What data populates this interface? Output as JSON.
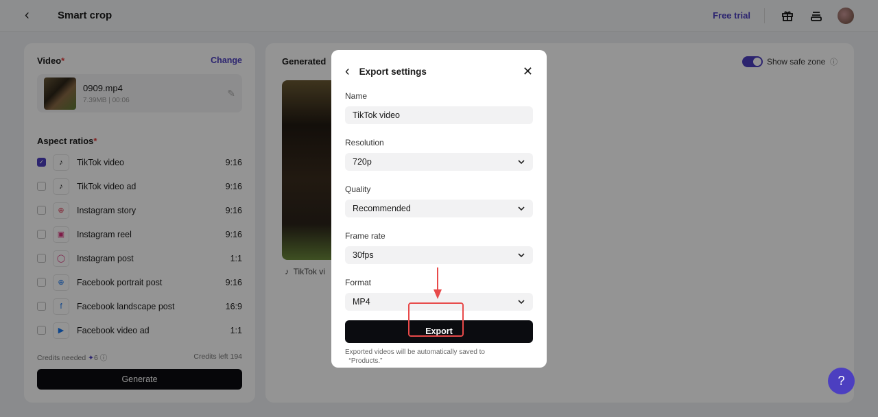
{
  "header": {
    "title": "Smart crop",
    "free_trial": "Free trial"
  },
  "left": {
    "video_label": "Video",
    "change": "Change",
    "video": {
      "name": "0909.mp4",
      "size": "7.39MB",
      "duration": "00:06"
    },
    "aspect_label": "Aspect ratios",
    "items": [
      {
        "name": "TikTok video",
        "ratio": "9:16",
        "checked": true,
        "icon": "tiktok-icon"
      },
      {
        "name": "TikTok video ad",
        "ratio": "9:16",
        "checked": false,
        "icon": "tiktok-icon"
      },
      {
        "name": "Instagram story",
        "ratio": "9:16",
        "checked": false,
        "icon": "instagram-story-icon"
      },
      {
        "name": "Instagram reel",
        "ratio": "9:16",
        "checked": false,
        "icon": "instagram-reel-icon"
      },
      {
        "name": "Instagram post",
        "ratio": "1:1",
        "checked": false,
        "icon": "instagram-icon"
      },
      {
        "name": "Facebook portrait post",
        "ratio": "9:16",
        "checked": false,
        "icon": "facebook-story-icon"
      },
      {
        "name": "Facebook landscape post",
        "ratio": "16:9",
        "checked": false,
        "icon": "facebook-icon"
      },
      {
        "name": "Facebook video ad",
        "ratio": "1:1",
        "checked": false,
        "icon": "facebook-video-icon"
      }
    ],
    "credits_needed": "Credits needed",
    "credits_value": "6",
    "credits_left": "Credits left 194",
    "generate": "Generate"
  },
  "main": {
    "title": "Generated",
    "safe_zone": "Show safe zone",
    "safe_zone_on": true,
    "preview_label": "TikTok vi"
  },
  "modal": {
    "title": "Export settings",
    "fields": [
      {
        "label": "Name",
        "value": "TikTok video",
        "type": "input"
      },
      {
        "label": "Resolution",
        "value": "720p",
        "type": "select"
      },
      {
        "label": "Quality",
        "value": "Recommended",
        "type": "select"
      },
      {
        "label": "Frame rate",
        "value": "30fps",
        "type": "select"
      },
      {
        "label": "Format",
        "value": "MP4",
        "type": "select"
      }
    ],
    "export": "Export",
    "note1": "Exported videos will be automatically saved to",
    "note2": "  “Products.”"
  },
  "colors": {
    "accent": "#4c3fc0",
    "annotation": "#e84a4a"
  }
}
